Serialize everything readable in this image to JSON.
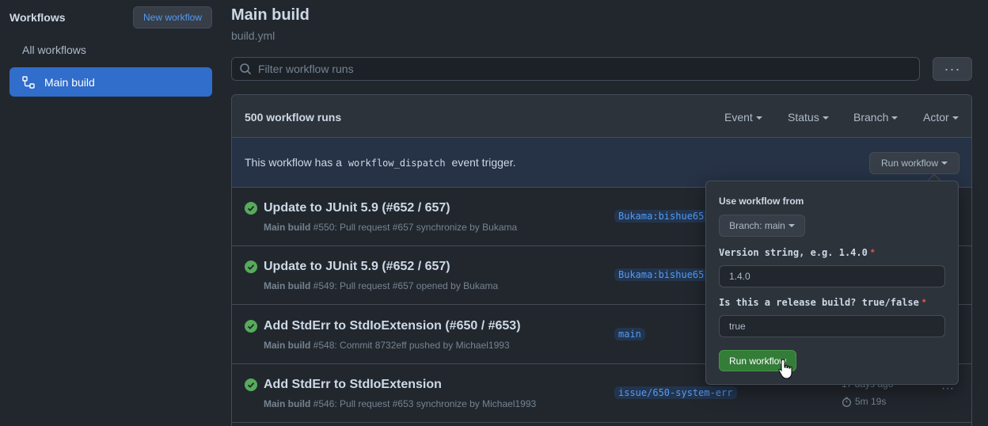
{
  "sidebar": {
    "title": "Workflows",
    "new_workflow_label": "New workflow",
    "all_workflows_label": "All workflows",
    "selected_item_label": "Main build"
  },
  "header": {
    "title": "Main build",
    "subtitle": "build.yml",
    "filter_placeholder": "Filter workflow runs",
    "more_label": "···"
  },
  "runs_box": {
    "count_label": "500 workflow runs",
    "filters": [
      "Event",
      "Status",
      "Branch",
      "Actor"
    ],
    "dispatch_prefix": "This workflow has a",
    "dispatch_code": "workflow_dispatch",
    "dispatch_suffix": "event trigger.",
    "run_workflow_label": "Run workflow"
  },
  "runs": [
    {
      "title": "Update to JUnit 5.9 (#652 / 657)",
      "workflow": "Main build",
      "detail": "#550: Pull request #657 synchronize by Bukama",
      "branch": "Bukama:bishue65",
      "time": "",
      "duration": ""
    },
    {
      "title": "Update to JUnit 5.9 (#652 / 657)",
      "workflow": "Main build",
      "detail": "#549: Pull request #657 opened by Bukama",
      "branch": "Bukama:bishue65",
      "time": "",
      "duration": ""
    },
    {
      "title": "Add StdErr to StdIoExtension (#650 / #653)",
      "workflow": "Main build",
      "detail": "#548: Commit 8732eff pushed by Michael1993",
      "branch": "main",
      "time": "",
      "duration": ""
    },
    {
      "title": "Add StdErr to StdIoExtension",
      "workflow": "Main build",
      "detail": "#546: Pull request #653 synchronize by Michael1993",
      "branch": "issue/650-system-err",
      "time": "17 days ago",
      "duration": "5m 19s"
    }
  ],
  "popup": {
    "use_from_label": "Use workflow from",
    "branch_label": "Branch: main",
    "field1_label": "Version string, e.g. 1.4.0",
    "field1_value": "1.4.0",
    "field2_label": "Is this a release build? true/false",
    "field2_value": "true",
    "required_mark": "*",
    "submit_label": "Run workflow"
  },
  "colors": {
    "background": "#22272e",
    "accent_blue": "#316dca",
    "success_green": "#57ab5a",
    "run_button_green": "#347d39"
  }
}
